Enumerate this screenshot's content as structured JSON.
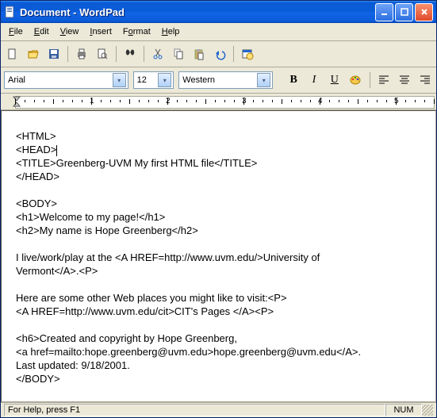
{
  "window": {
    "title": "Document - WordPad"
  },
  "menu": {
    "file": "File",
    "edit": "Edit",
    "view": "View",
    "insert": "Insert",
    "format": "Format",
    "help": "Help"
  },
  "format_bar": {
    "font_name": "Arial",
    "font_size": "12",
    "charset": "Western"
  },
  "ruler": {
    "n1": "1",
    "n2": "2",
    "n3": "3",
    "n4": "4",
    "n5": "5"
  },
  "document": {
    "l01": "<HTML>",
    "l02": "<HEAD>",
    "l03": "<TITLE>Greenberg-UVM My first HTML file</TITLE>",
    "l04": "</HEAD>",
    "l05": "",
    "l06": "<BODY>",
    "l07": "<h1>Welcome to my page!</h1>",
    "l08": "<h2>My name is Hope Greenberg</h2>",
    "l09": "",
    "l10": "I live/work/play at the <A HREF=http://www.uvm.edu/>University of",
    "l11": "Vermont</A>.<P>",
    "l12": "",
    "l13": "Here are some other Web places you might like to visit:<P>",
    "l14": "<A HREF=http://www.uvm.edu/cit>CIT's Pages </A><P>",
    "l15": "",
    "l16": "<h6>Created and copyright by Hope Greenberg,",
    "l17": "<a href=mailto:hope.greenberg@uvm.edu>hope.greenberg@uvm.edu</A>.",
    "l18": "Last updated: 9/18/2001.",
    "l19": "</BODY>"
  },
  "status": {
    "help": "For Help, press F1",
    "num": "NUM"
  }
}
